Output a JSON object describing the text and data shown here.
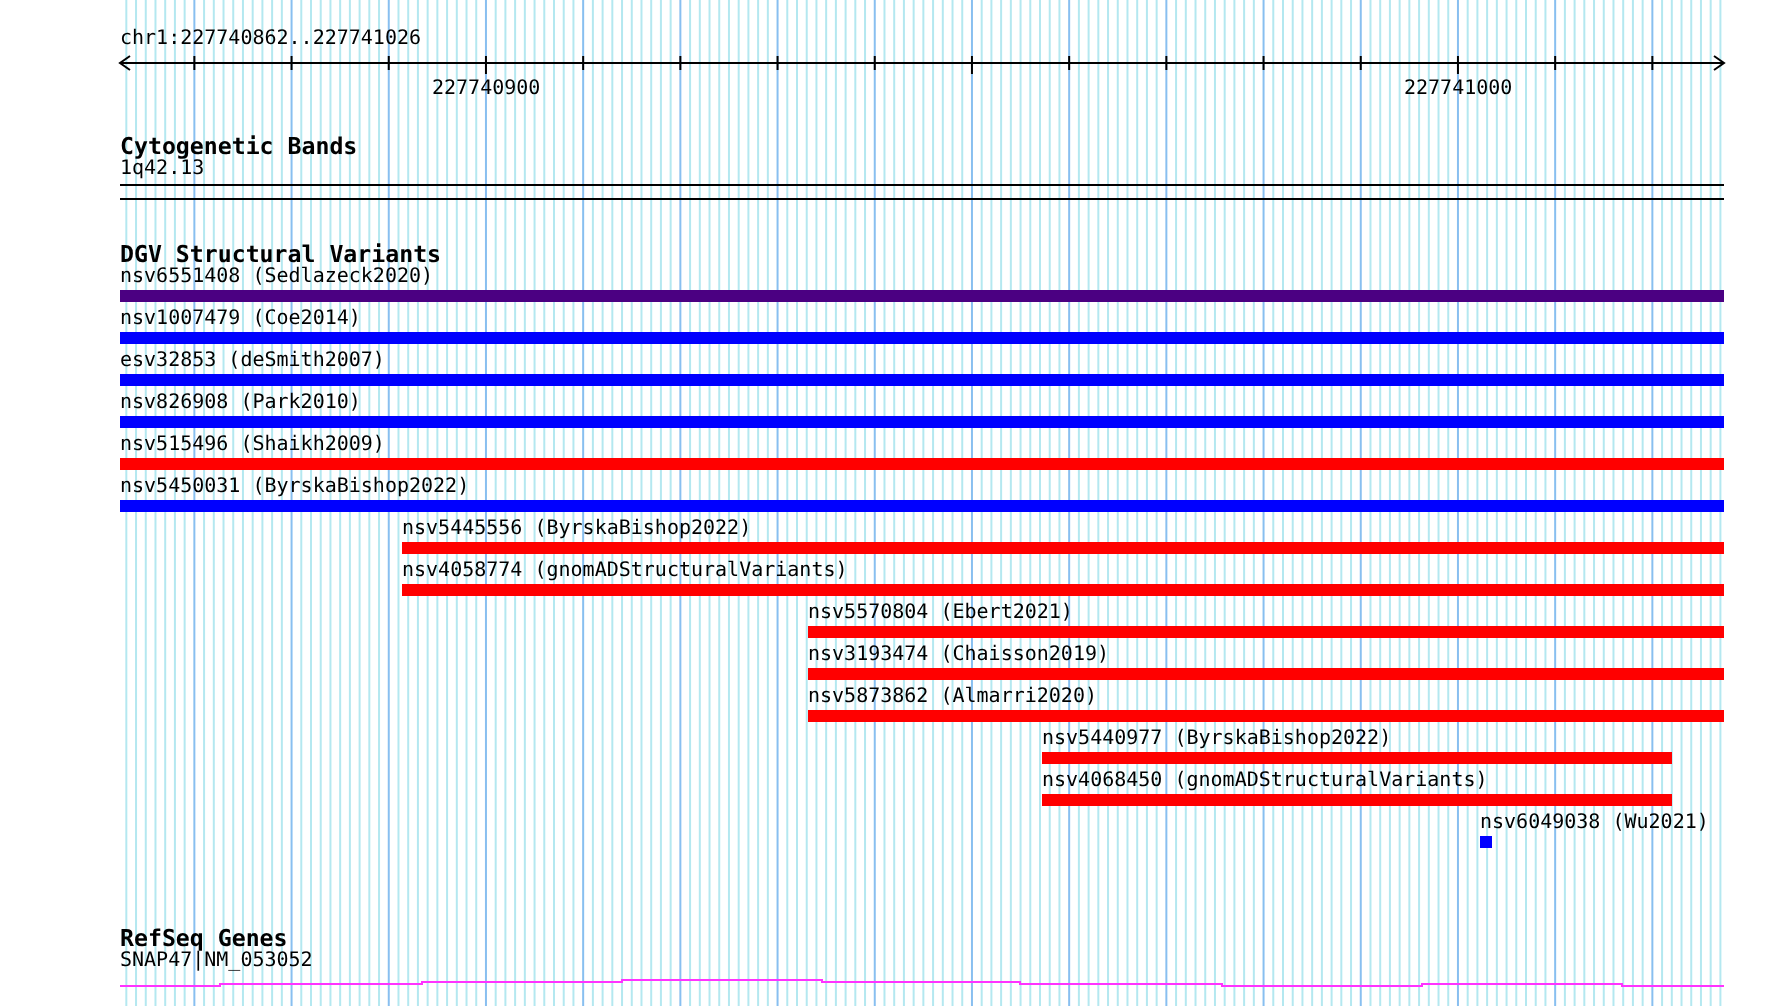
{
  "ruler": {
    "region": "chr1:227740862..227741026",
    "tick_labels": [
      "227740900",
      "227741000"
    ]
  },
  "cytoband_track": {
    "title": "Cytogenetic Bands",
    "band": "1q42.13"
  },
  "variant_track": {
    "title": "DGV Structural Variants",
    "features": [
      {
        "label": "nsv6551408 (Sedlazeck2020)",
        "color": "#4b0082"
      },
      {
        "label": "nsv1007479 (Coe2014)",
        "color": "#0000ff"
      },
      {
        "label": "esv32853 (deSmith2007)",
        "color": "#0000ff"
      },
      {
        "label": "nsv826908 (Park2010)",
        "color": "#0000ff"
      },
      {
        "label": "nsv515496 (Shaikh2009)",
        "color": "#ff0000"
      },
      {
        "label": "nsv5450031 (ByrskaBishop2022)",
        "color": "#0000ff"
      },
      {
        "label": "nsv5445556 (ByrskaBishop2022)",
        "color": "#ff0000"
      },
      {
        "label": "nsv4058774 (gnomADStructuralVariants)",
        "color": "#ff0000"
      },
      {
        "label": "nsv5570804 (Ebert2021)",
        "color": "#ff0000"
      },
      {
        "label": "nsv3193474 (Chaisson2019)",
        "color": "#ff0000"
      },
      {
        "label": "nsv5873862 (Almarri2020)",
        "color": "#ff0000"
      },
      {
        "label": "nsv5440977 (ByrskaBishop2022)",
        "color": "#ff0000"
      },
      {
        "label": "nsv4068450 (gnomADStructuralVariants)",
        "color": "#ff0000"
      },
      {
        "label": "nsv6049038 (Wu2021)",
        "color": "#0000ff"
      }
    ]
  },
  "gene_track": {
    "title": "RefSeq Genes",
    "gene": "SNAP47|NM_053052"
  }
}
